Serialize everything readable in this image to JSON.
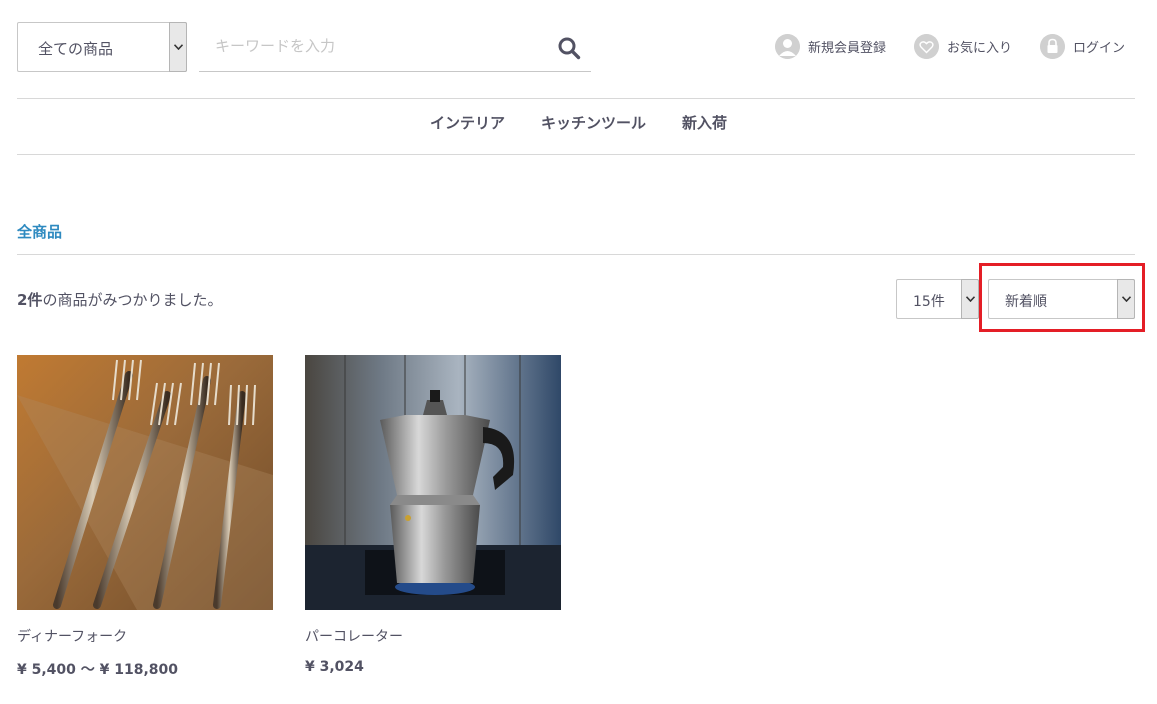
{
  "header": {
    "category_select": "全ての商品",
    "search_placeholder": "キーワードを入力",
    "links": {
      "register": "新規会員登録",
      "favorites": "お気に入り",
      "login": "ログイン"
    }
  },
  "nav": [
    "インテリア",
    "キッチンツール",
    "新入荷"
  ],
  "page_title": "全商品",
  "result": {
    "count": "2件",
    "text": "の商品がみつかりました。"
  },
  "controls": {
    "per_page": "15件",
    "sort": "新着順"
  },
  "products": [
    {
      "name": "ディナーフォーク",
      "price": "¥ 5,400 ～ ¥ 118,800"
    },
    {
      "name": "パーコレーター",
      "price": "¥ 3,024"
    }
  ],
  "colors": {
    "accent": "#2e8ac0",
    "highlight": "#e41e26",
    "text": "#525263"
  }
}
